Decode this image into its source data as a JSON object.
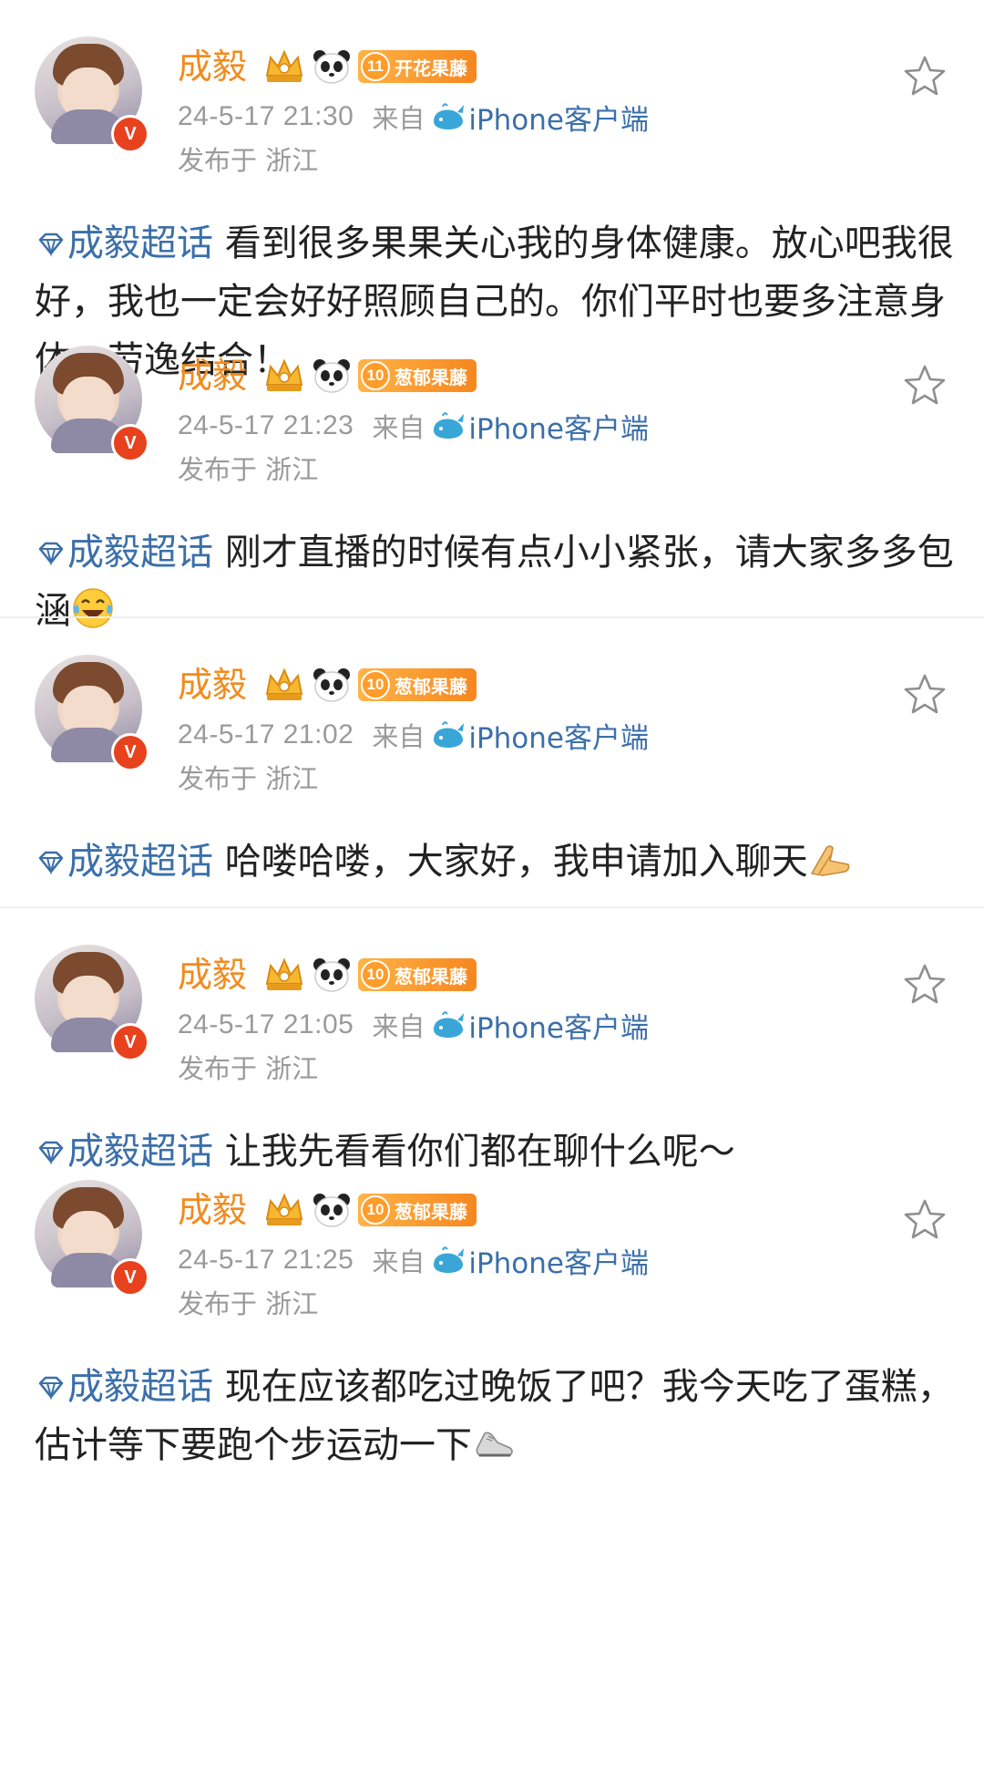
{
  "posts": [
    {
      "user_name": "成毅",
      "fan_level": "11",
      "fan_label": "开花果藤",
      "time": "24-5-17 21:30",
      "from_label": "来自",
      "client": "iPhone客户端",
      "location": "发布于 浙江",
      "topic": "成毅超话",
      "text": " 看到很多果果关心我的身体健康。放心吧我很好，我也一定会好好照顾自己的。你们平时也要多注意身体，劳逸结合！",
      "emoji": ""
    },
    {
      "user_name": "成毅",
      "fan_level": "10",
      "fan_label": "葱郁果藤",
      "time": "24-5-17 21:23",
      "from_label": "来自",
      "client": "iPhone客户端",
      "location": "发布于 浙江",
      "topic": "成毅超话",
      "text": " 刚才直播的时候有点小小紧张，请大家多多包涵",
      "emoji": "laughing-tears"
    },
    {
      "user_name": "成毅",
      "fan_level": "10",
      "fan_label": "葱郁果藤",
      "time": "24-5-17 21:02",
      "from_label": "来自",
      "client": "iPhone客户端",
      "location": "发布于 浙江",
      "topic": "成毅超话",
      "text": " 哈喽哈喽，大家好，我申请加入聊天",
      "emoji": "palms-together"
    },
    {
      "user_name": "成毅",
      "fan_level": "10",
      "fan_label": "葱郁果藤",
      "time": "24-5-17 21:05",
      "from_label": "来自",
      "client": "iPhone客户端",
      "location": "发布于 浙江",
      "topic": "成毅超话",
      "text": " 让我先看看你们都在聊什么呢～",
      "emoji": ""
    },
    {
      "user_name": "成毅",
      "fan_level": "10",
      "fan_label": "葱郁果藤",
      "time": "24-5-17 21:25",
      "from_label": "来自",
      "client": "iPhone客户端",
      "location": "发布于 浙江",
      "topic": "成毅超话",
      "text": " 现在应该都吃过晚饭了吧？我今天吃了蛋糕，估计等下要跑个步运动一下",
      "emoji": "running-shoe"
    }
  ],
  "colors": {
    "name": "#f28b1d",
    "link": "#3b6faa",
    "meta": "#9a9a9a",
    "text": "#222222",
    "verified": "#e7421d"
  },
  "icons": {
    "crown": "crown-icon",
    "panda": "panda-icon",
    "whale": "whale-icon",
    "star": "star-icon",
    "topic": "diamond-topic-icon"
  }
}
